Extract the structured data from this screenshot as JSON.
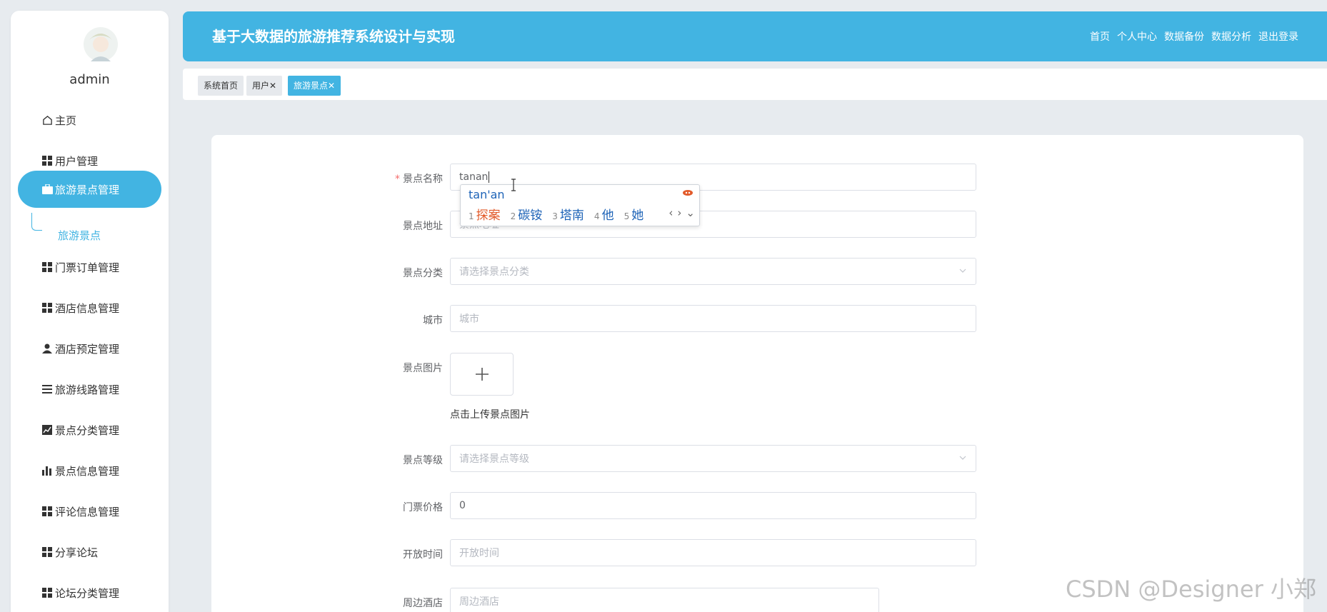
{
  "sidebar": {
    "username": "admin",
    "items": [
      {
        "label": "主页",
        "icon": "home-icon"
      },
      {
        "label": "用户管理",
        "icon": "grid-icon"
      },
      {
        "label": "旅游景点管理",
        "icon": "briefcase-icon",
        "active": true
      },
      {
        "label": "门票订单管理",
        "icon": "grid-icon"
      },
      {
        "label": "酒店信息管理",
        "icon": "grid-icon"
      },
      {
        "label": "酒店预定管理",
        "icon": "user-icon"
      },
      {
        "label": "旅游线路管理",
        "icon": "list-icon"
      },
      {
        "label": "景点分类管理",
        "icon": "trend-chart-icon"
      },
      {
        "label": "景点信息管理",
        "icon": "bar-chart-icon"
      },
      {
        "label": "评论信息管理",
        "icon": "grid-icon"
      },
      {
        "label": "分享论坛",
        "icon": "grid-icon"
      },
      {
        "label": "论坛分类管理",
        "icon": "grid-icon"
      }
    ],
    "subitem": "旅游景点"
  },
  "header": {
    "title": "基于大数据的旅游推荐系统设计与实现",
    "nav": [
      "首页",
      "个人中心",
      "数据备份",
      "数据分析",
      "退出登录"
    ]
  },
  "tabs": [
    {
      "label": "系统首页"
    },
    {
      "label": "用户",
      "close": "✕"
    },
    {
      "label": "旅游景点",
      "close": "✕",
      "active": true
    }
  ],
  "form": {
    "name": {
      "label": "景点名称",
      "value": "tanan",
      "required": "*"
    },
    "address": {
      "label": "景点地址",
      "placeholder": "景点地址"
    },
    "category": {
      "label": "景点分类",
      "placeholder": "请选择景点分类"
    },
    "city": {
      "label": "城市",
      "placeholder": "城市"
    },
    "image": {
      "label": "景点图片",
      "hint": "点击上传景点图片"
    },
    "level": {
      "label": "景点等级",
      "placeholder": "请选择景点等级"
    },
    "price": {
      "label": "门票价格",
      "value": "0"
    },
    "open_time": {
      "label": "开放时间",
      "placeholder": "开放时间"
    },
    "hotel": {
      "label": "周边酒店",
      "placeholder": "周边酒店"
    }
  },
  "ime": {
    "composition": "tan'an",
    "candidates": [
      {
        "num": "1",
        "text": "探案"
      },
      {
        "num": "2",
        "text": "碳铵"
      },
      {
        "num": "3",
        "text": "塔南"
      },
      {
        "num": "4",
        "text": "他"
      },
      {
        "num": "5",
        "text": "她"
      }
    ],
    "nav": [
      "‹",
      "›",
      "⌄"
    ]
  },
  "watermark": "CSDN @Designer 小郑",
  "colors": {
    "accent": "#42b4e2",
    "required": "#f56c6c"
  }
}
